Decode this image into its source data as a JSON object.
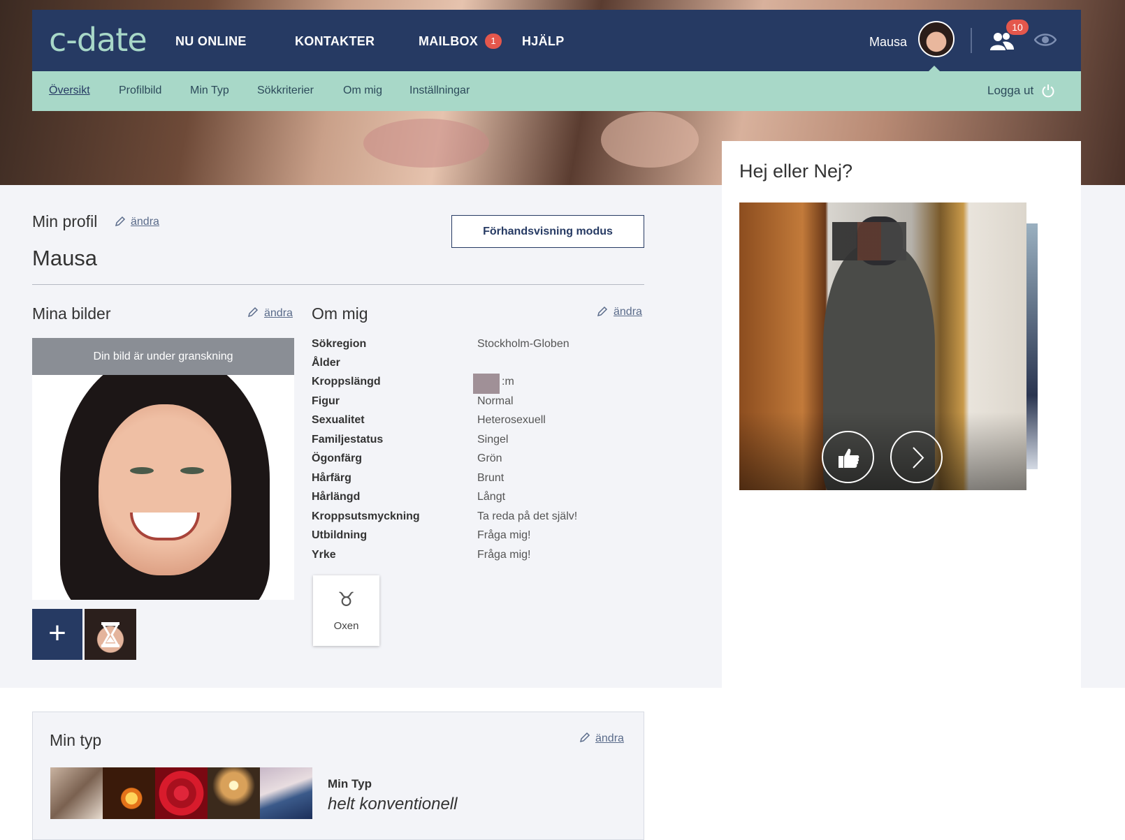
{
  "nav": {
    "logo": "c-date",
    "links": [
      "NU ONLINE",
      "KONTAKTER",
      "MAILBOX",
      "HJÄLP"
    ],
    "mailbox_badge": "1",
    "user_name": "Mausa",
    "contacts_badge": "10"
  },
  "subnav": {
    "items": [
      "Översikt",
      "Profilbild",
      "Min Typ",
      "Sökkriterier",
      "Om mig",
      "Inställningar"
    ],
    "active": "Översikt",
    "logout": "Logga ut"
  },
  "profile": {
    "title": "Min profil",
    "edit": "ändra",
    "name": "Mausa",
    "preview_button": "Förhandsvisning modus"
  },
  "photos": {
    "title": "Mina bilder",
    "edit": "ändra",
    "review_banner": "Din bild är under granskning",
    "add_label": "+"
  },
  "about": {
    "title": "Om mig",
    "edit": "ändra",
    "rows": [
      {
        "label": "Sökregion",
        "value": "Stockholm-Globen"
      },
      {
        "label": "Ålder",
        "value": ""
      },
      {
        "label": "Kroppslängd",
        "value": ":m"
      },
      {
        "label": "Figur",
        "value": "Normal"
      },
      {
        "label": "Sexualitet",
        "value": "Heterosexuell"
      },
      {
        "label": "Familjestatus",
        "value": "Singel"
      },
      {
        "label": "Ögonfärg",
        "value": "Grön"
      },
      {
        "label": "Hårfärg",
        "value": "Brunt"
      },
      {
        "label": "Hårlängd",
        "value": "Långt"
      },
      {
        "label": "Kroppsutsmyckning",
        "value": "Ta reda på det själv!"
      },
      {
        "label": "Utbildning",
        "value": "Fråga mig!"
      },
      {
        "label": "Yrke",
        "value": "Fråga mig!"
      }
    ],
    "zodiac": {
      "glyph": "♉",
      "label": "Oxen"
    }
  },
  "hej": {
    "title": "Hej eller Nej?"
  },
  "min_typ": {
    "title": "Min typ",
    "edit": "ändra",
    "label": "Min Typ",
    "value": "helt konventionell"
  },
  "colors": {
    "navy": "#263a63",
    "mint": "#a8d8c8",
    "badge_red": "#e4574c",
    "panel_gray": "#f3f4f8"
  }
}
